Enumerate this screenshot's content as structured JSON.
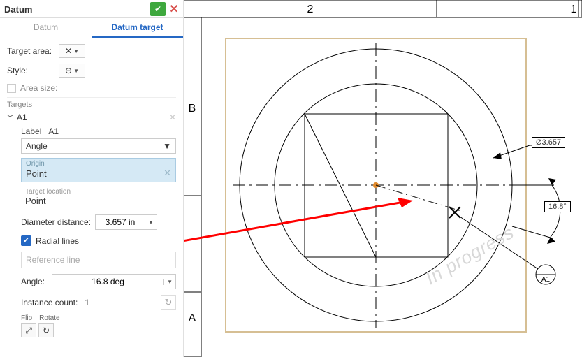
{
  "panel": {
    "title": "Datum",
    "tabs": {
      "datum": "Datum",
      "datum_target": "Datum target",
      "active": "datum_target"
    },
    "target_area_label": "Target area:",
    "target_area_value": "✕",
    "style_label": "Style:",
    "style_value": "⊖",
    "area_size_label": "Area size:",
    "targets_header": "Targets",
    "target": {
      "name": "A1",
      "label_field": "Label",
      "label_value": "A1",
      "angle_dropdown": "Angle",
      "origin_label": "Origin",
      "origin_value": "Point",
      "target_loc_label": "Target location",
      "target_loc_value": "Point",
      "diameter_label": "Diameter distance:",
      "diameter_value": "3.657 in",
      "radial_lines_label": "Radial lines",
      "reference_line_placeholder": "Reference line",
      "angle_label": "Angle:",
      "angle_value": "16.8 deg",
      "instance_label": "Instance count:",
      "instance_value": "1",
      "flip_label": "Flip",
      "rotate_label": "Rotate"
    }
  },
  "drawing": {
    "zone_col_left": "2",
    "zone_col_right": "1",
    "zone_row_top": "B",
    "zone_row_bottom": "A",
    "diameter_callout": "Ø3.657",
    "angle_callout": "16.8°",
    "datum_symbol": "A1",
    "watermark": "In progress"
  }
}
